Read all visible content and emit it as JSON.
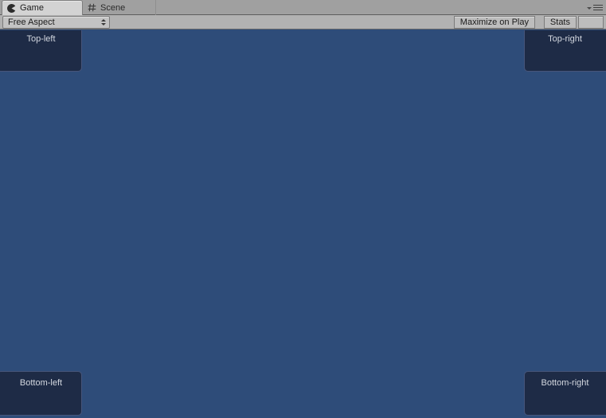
{
  "window": {
    "tabs": [
      {
        "label": "Game",
        "icon": "game-pacman-icon",
        "active": true
      },
      {
        "label": "Scene",
        "icon": "scene-grid-icon",
        "active": false
      }
    ],
    "menu_icon": "hamburger-menu-icon"
  },
  "toolbar": {
    "aspect": {
      "value": "Free Aspect",
      "icon": "updown-arrows-icon"
    },
    "maximize_on_play": "Maximize on Play",
    "stats": "Stats",
    "gizmos": ""
  },
  "game": {
    "background_color": "#2e4c79",
    "panel_fill_color": "#1e2b46",
    "panel_border_color": "#47557a",
    "panel_text_color": "#d4d8e0",
    "panels": [
      {
        "id": "top-left",
        "label": "Top-left"
      },
      {
        "id": "top-right",
        "label": "Top-right"
      },
      {
        "id": "bottom-left",
        "label": "Bottom-left"
      },
      {
        "id": "bottom-right",
        "label": "Bottom-right"
      }
    ]
  }
}
